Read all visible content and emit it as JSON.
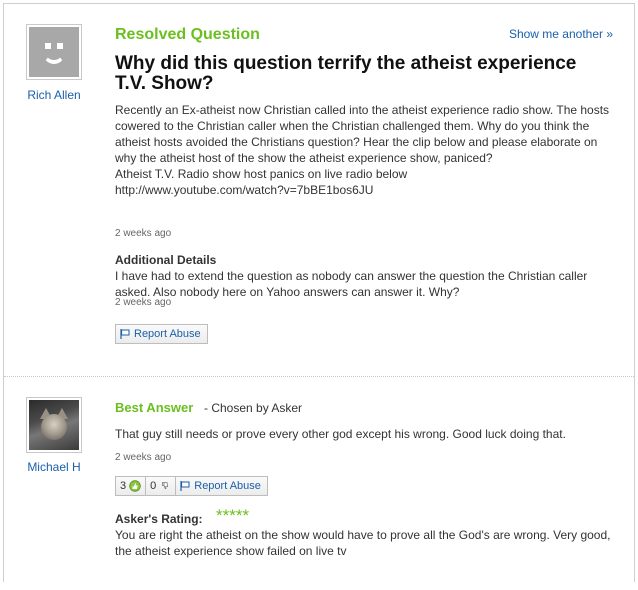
{
  "question": {
    "status_label": "Resolved Question",
    "show_another": "Show me another »",
    "asker_name": "Rich Allen",
    "title": "Why did this question terrify the atheist experience T.V. Show?",
    "body": "Recently an Ex-atheist now Christian called into the atheist experience radio show. The hosts cowered to the Christian caller when the Christian challenged them. Why do you think the atheist hosts avoided the Christians question? Hear the clip below and please elaborate on why the atheist host of the show the atheist experience show, paniced?\nAtheist T.V. Radio show host panics on live radio below\nhttp://www.youtube.com/watch?v=7bBE1bos6JU",
    "timestamp": "2 weeks ago",
    "additional_details_label": "Additional Details",
    "additional_details": "I have had to extend the question as nobody can answer the question the Christian caller asked. Also nobody here on Yahoo answers can answer it. Why?",
    "details_timestamp": "2 weeks ago",
    "report_label": "Report Abuse"
  },
  "answer": {
    "best_answer_label": "Best Answer",
    "chosen_by": "- Chosen by Asker",
    "answerer_name": "Michael H",
    "body": "That guy still needs or prove every other god except his wrong. Good luck doing that.",
    "timestamp": "2 weeks ago",
    "thumbs_up": "3",
    "thumbs_down": "0",
    "report_label": "Report Abuse",
    "rating_label": "Asker's Rating:",
    "rating_stars": "*****",
    "rating": 5,
    "rating_comment": "You are right the atheist on the show would have to prove all the God's are wrong. Very good, the atheist experience show failed on live tv"
  },
  "colors": {
    "accent_green": "#6bbf1f",
    "link_blue": "#1b5faa"
  },
  "icons": {
    "asker_avatar": "default-smiley-avatar",
    "answerer_avatar": "cat-photo-avatar",
    "report": "flag-icon",
    "thumbs_up": "thumbs-up-icon",
    "thumbs_down": "thumbs-down-icon"
  }
}
